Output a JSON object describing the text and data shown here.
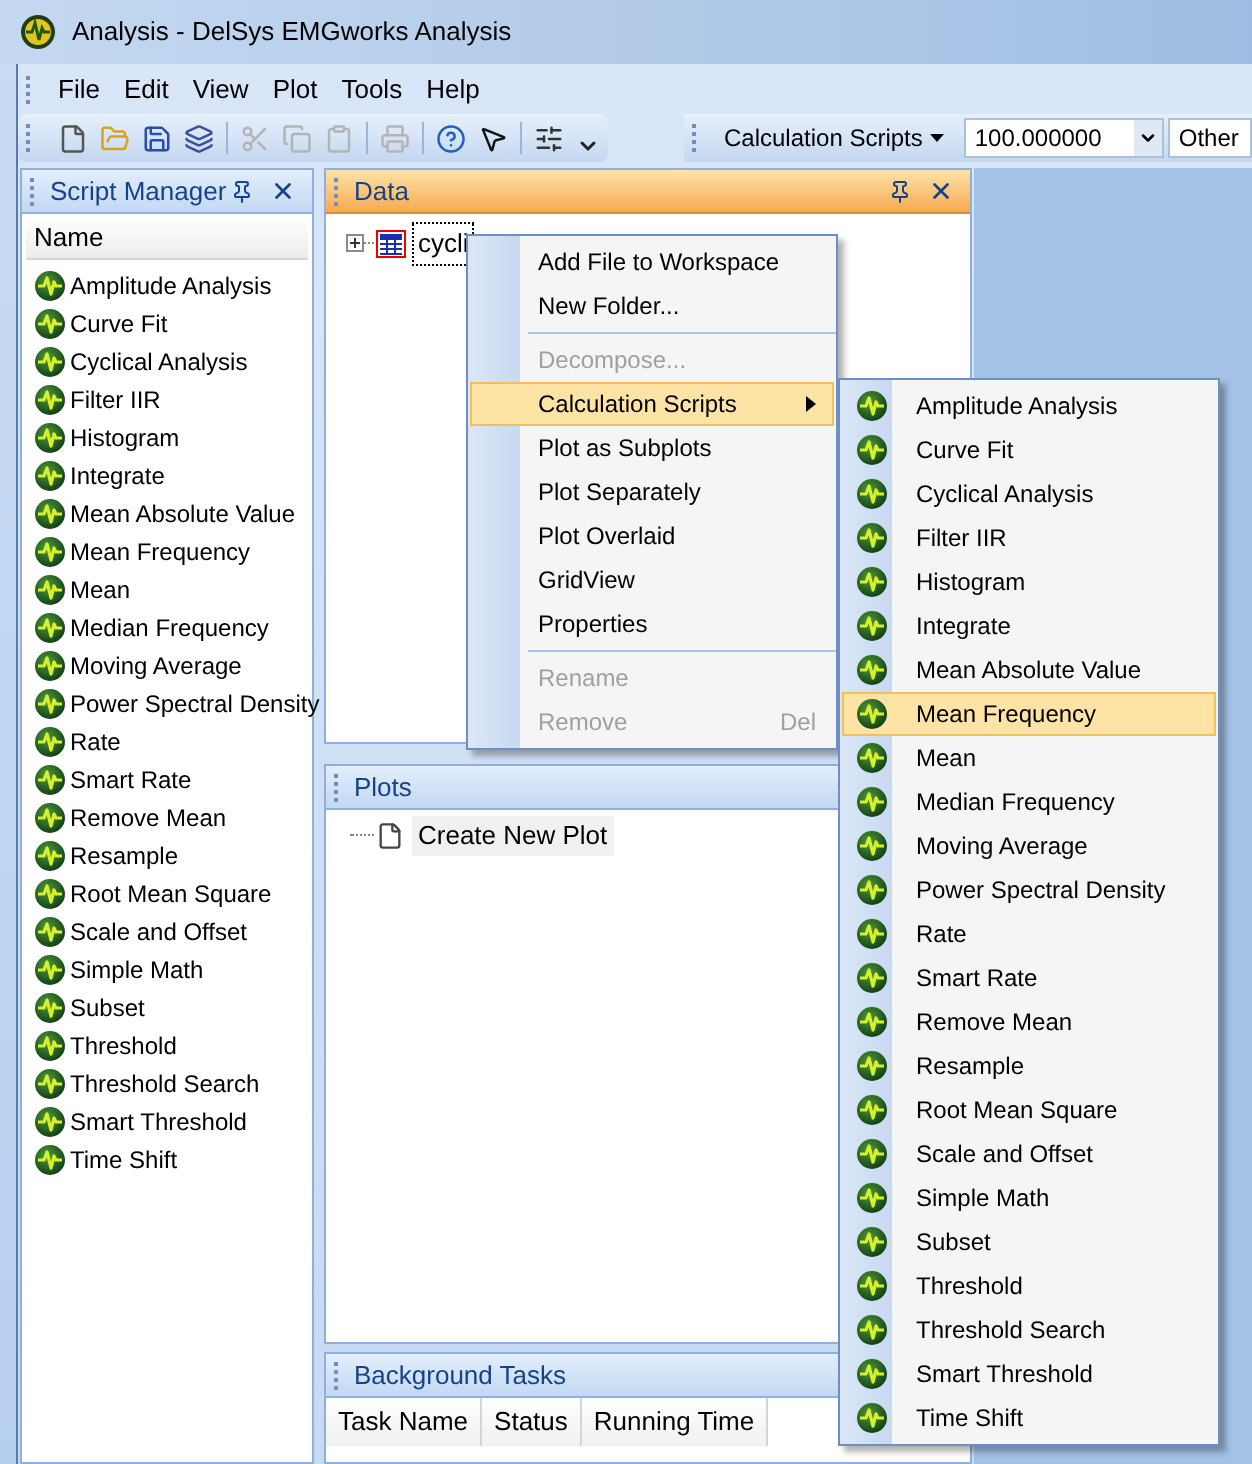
{
  "window": {
    "title": "Analysis - DelSys EMGworks Analysis"
  },
  "menu_bar": [
    {
      "label": "File"
    },
    {
      "label": "Edit"
    },
    {
      "label": "View"
    },
    {
      "label": "Plot"
    },
    {
      "label": "Tools"
    },
    {
      "label": "Help"
    }
  ],
  "toolbar": [
    {
      "disabled": false
    },
    {
      "disabled": false
    },
    {
      "disabled": false
    },
    {
      "disabled": false
    },
    {
      "disabled": true
    },
    {
      "disabled": true
    },
    {
      "disabled": true
    },
    {
      "disabled": true
    },
    {
      "disabled": false
    },
    {
      "disabled": false
    },
    {
      "disabled": false
    }
  ],
  "script_toolbar": {
    "dropdown": "Calculation Scripts",
    "value": "100.000000",
    "unit": "Other"
  },
  "script_manager": {
    "title": "Script Manager",
    "active": false,
    "column": "Name",
    "scripts": [
      "Amplitude Analysis",
      "Curve Fit",
      "Cyclical Analysis",
      "Filter IIR",
      "Histogram",
      "Integrate",
      "Mean Absolute Value",
      "Mean Frequency",
      "Mean",
      "Median Frequency",
      "Moving Average",
      "Power Spectral Density",
      "Rate",
      "Smart Rate",
      "Remove Mean",
      "Resample",
      "Root Mean Square",
      "Scale and Offset",
      "Simple Math",
      "Subset",
      "Threshold",
      "Threshold Search",
      "Smart Threshold",
      "Time Shift"
    ]
  },
  "data_panel": {
    "title": "Data",
    "active": true,
    "tree": [
      {
        "label": "cycli",
        "expanded": false
      }
    ]
  },
  "plots_panel": {
    "title": "Plots",
    "active": false,
    "items": [
      {
        "label": "Create New Plot"
      }
    ]
  },
  "background_tasks": {
    "title": "Background Tasks",
    "active": false,
    "columns": [
      "Task Name",
      "Status",
      "Running Time"
    ]
  },
  "context_menu": {
    "items": [
      {
        "kind": "item",
        "label": "Add File to Workspace",
        "disabled": false,
        "highlighted": false
      },
      {
        "kind": "item",
        "label": "New Folder...",
        "disabled": false,
        "highlighted": false
      },
      {
        "kind": "separator"
      },
      {
        "kind": "item",
        "label": "Decompose...",
        "disabled": true,
        "highlighted": false
      },
      {
        "kind": "submenu",
        "label": "Calculation Scripts",
        "disabled": false,
        "highlighted": true
      },
      {
        "kind": "item",
        "label": "Plot as Subplots",
        "disabled": false,
        "highlighted": false
      },
      {
        "kind": "item",
        "label": "Plot Separately",
        "disabled": false,
        "highlighted": false
      },
      {
        "kind": "item",
        "label": "Plot Overlaid",
        "disabled": false,
        "highlighted": false
      },
      {
        "kind": "item",
        "label": "GridView",
        "disabled": false,
        "highlighted": false
      },
      {
        "kind": "item",
        "label": "Properties",
        "disabled": false,
        "highlighted": false
      },
      {
        "kind": "separator"
      },
      {
        "kind": "item",
        "label": "Rename",
        "disabled": true,
        "highlighted": false
      },
      {
        "kind": "item",
        "label": "Remove",
        "shortcut": "Del",
        "disabled": true,
        "highlighted": false
      }
    ]
  },
  "submenu": {
    "items": [
      {
        "label": "Amplitude Analysis",
        "highlighted": false
      },
      {
        "label": "Curve Fit",
        "highlighted": false
      },
      {
        "label": "Cyclical Analysis",
        "highlighted": false
      },
      {
        "label": "Filter IIR",
        "highlighted": false
      },
      {
        "label": "Histogram",
        "highlighted": false
      },
      {
        "label": "Integrate",
        "highlighted": false
      },
      {
        "label": "Mean Absolute Value",
        "highlighted": false
      },
      {
        "label": "Mean Frequency",
        "highlighted": true
      },
      {
        "label": "Mean",
        "highlighted": false
      },
      {
        "label": "Median Frequency",
        "highlighted": false
      },
      {
        "label": "Moving Average",
        "highlighted": false
      },
      {
        "label": "Power Spectral Density",
        "highlighted": false
      },
      {
        "label": "Rate",
        "highlighted": false
      },
      {
        "label": "Smart Rate",
        "highlighted": false
      },
      {
        "label": "Remove Mean",
        "highlighted": false
      },
      {
        "label": "Resample",
        "highlighted": false
      },
      {
        "label": "Root Mean Square",
        "highlighted": false
      },
      {
        "label": "Scale and Offset",
        "highlighted": false
      },
      {
        "label": "Simple Math",
        "highlighted": false
      },
      {
        "label": "Subset",
        "highlighted": false
      },
      {
        "label": "Threshold",
        "highlighted": false
      },
      {
        "label": "Threshold Search",
        "highlighted": false
      },
      {
        "label": "Smart Threshold",
        "highlighted": false
      },
      {
        "label": "Time Shift",
        "highlighted": false
      }
    ]
  }
}
